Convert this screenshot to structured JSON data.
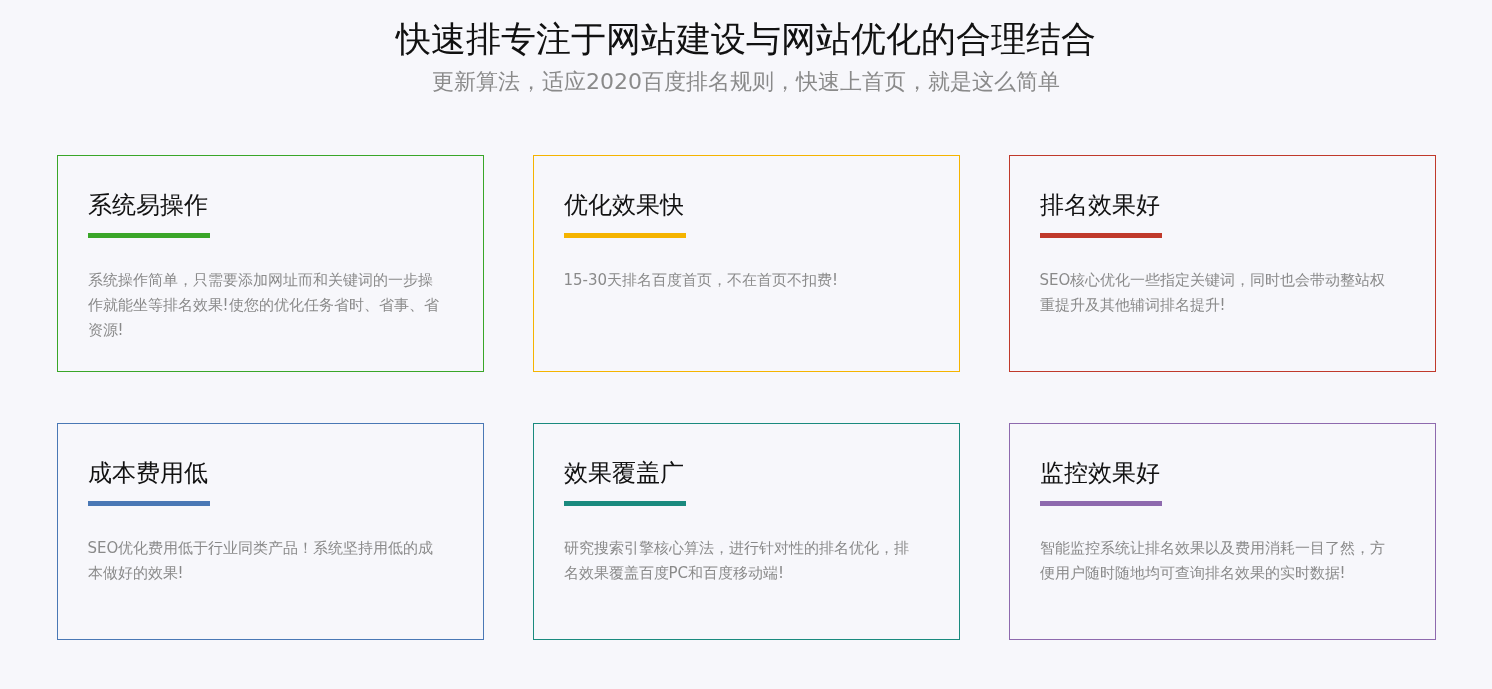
{
  "header": {
    "title": "快速排专注于网站建设与网站优化的合理结合",
    "subtitle": "更新算法，适应2020百度排名规则，快速上首页，就是这么简单"
  },
  "cards": [
    {
      "title": "系统易操作",
      "color": "#3aa628",
      "text": "系统操作简单，只需要添加网址而和关键词的一步操作就能坐等排名效果!使您的优化任务省时、省事、省资源!"
    },
    {
      "title": "优化效果快",
      "color": "#f5b400",
      "text": "15-30天排名百度首页，不在首页不扣费!"
    },
    {
      "title": "排名效果好",
      "color": "#c0392b",
      "text": "SEO核心优化一些指定关键词，同时也会带动整站权重提升及其他辅词排名提升!"
    },
    {
      "title": "成本费用低",
      "color": "#4a78b5",
      "text": "SEO优化费用低于行业同类产品！系统坚持用低的成本做好的效果!"
    },
    {
      "title": "效果覆盖广",
      "color": "#1a8a7e",
      "text": "研究搜索引擎核心算法，进行针对性的排名优化，排名效果覆盖百度PC和百度移动端!"
    },
    {
      "title": "监控效果好",
      "color": "#8e6aae",
      "text": "智能监控系统让排名效果以及费用消耗一目了然，方便用户随时随地均可查询排名效果的实时数据!"
    }
  ]
}
